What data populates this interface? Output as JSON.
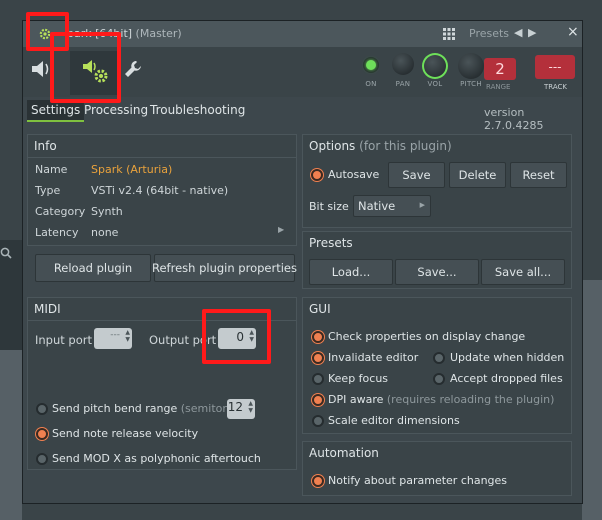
{
  "window": {
    "title": "park [64bit]",
    "title_sub": "(Master)",
    "presets_label": "Presets",
    "close_label": "×"
  },
  "toolbar": {
    "knobs": [
      {
        "label": "ON"
      },
      {
        "label": "PAN"
      },
      {
        "label": "VOL"
      },
      {
        "label": "PITCH"
      }
    ],
    "range_label": "RANGE",
    "pitch_value": "2",
    "track_value": "---",
    "track_label": "TRACK"
  },
  "tabs": [
    {
      "label": "Settings",
      "active": true
    },
    {
      "label": "Processing",
      "active": false
    },
    {
      "label": "Troubleshooting",
      "active": false
    }
  ],
  "version": "version 2.7.0.4285",
  "info": {
    "heading": "Info",
    "rows": [
      {
        "label": "Name",
        "value": "Spark (Arturia)"
      },
      {
        "label": "Type",
        "value": "VSTi v2.4 (64bit - native)"
      },
      {
        "label": "Category",
        "value": "Synth"
      },
      {
        "label": "Latency",
        "value": "none"
      }
    ],
    "reload_button": "Reload plugin",
    "refresh_button": "Refresh plugin properties"
  },
  "options": {
    "heading": "Options",
    "heading_note": "(for this plugin)",
    "autosave_label": "Autosave",
    "save_button": "Save",
    "delete_button": "Delete",
    "reset_button": "Reset",
    "bitsize_label": "Bit size",
    "bitsize_value": "Native"
  },
  "presets": {
    "heading": "Presets",
    "load_button": "Load...",
    "save_button": "Save...",
    "save_all_button": "Save all..."
  },
  "midi": {
    "heading": "MIDI",
    "input_port_label": "Input port",
    "input_port_value": "---",
    "output_port_label": "Output port",
    "output_port_value": "0",
    "pitch_bend_label": "Send pitch bend range",
    "pitch_bend_note": "(semitones)",
    "pitch_bend_value": "12",
    "note_release_label": "Send note release velocity",
    "mod_x_label": "Send MOD X as polyphonic aftertouch"
  },
  "gui": {
    "heading": "GUI",
    "check_properties": "Check properties on display change",
    "invalidate_editor": "Invalidate editor",
    "update_hidden": "Update when hidden",
    "keep_focus": "Keep focus",
    "accept_dropped": "Accept dropped files",
    "dpi_aware": "DPI aware",
    "dpi_note": "(requires reloading the plugin)",
    "scale_editor": "Scale editor dimensions"
  },
  "automation": {
    "heading": "Automation",
    "notify_label": "Notify about parameter changes"
  },
  "colors": {
    "accent_orange": "#f08050",
    "name_value": "#e9a23c",
    "highlight": "#ff1a1a",
    "led_green": "#6ee05a"
  },
  "icons": [
    "gear-icon",
    "grid-icon",
    "speaker-icon",
    "plugin-gear-icon",
    "wrench-icon",
    "search-icon",
    "chevron-left-icon",
    "chevron-right-icon",
    "close-icon"
  ]
}
